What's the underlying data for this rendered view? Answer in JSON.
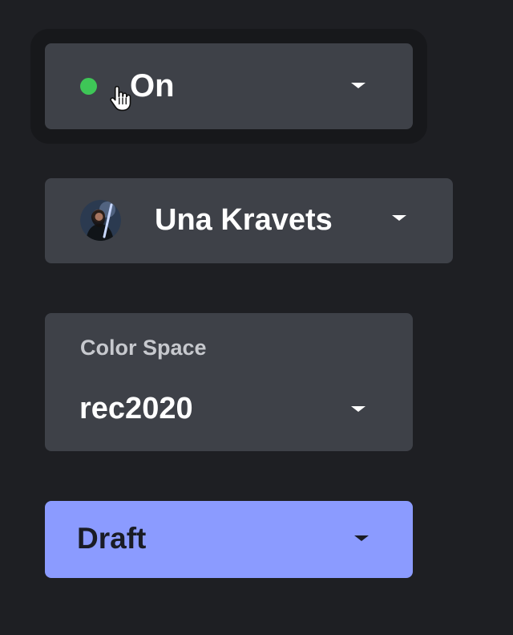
{
  "status_select": {
    "value": "On",
    "indicator_color": "#3ec657",
    "caret_icon": "caret-down-icon"
  },
  "user_select": {
    "value": "Una Kravets",
    "avatar_icon": "avatar",
    "caret_icon": "caret-down-icon"
  },
  "colorspace_select": {
    "label": "Color Space",
    "value": "rec2020",
    "caret_icon": "caret-down-icon"
  },
  "draft_select": {
    "value": "Draft",
    "background_color": "#8b9bff",
    "caret_icon": "caret-down-icon"
  },
  "colors": {
    "page_background": "#1e1f23",
    "select_background": "#3e4148"
  },
  "cursor_icon": "hand-pointer-icon"
}
